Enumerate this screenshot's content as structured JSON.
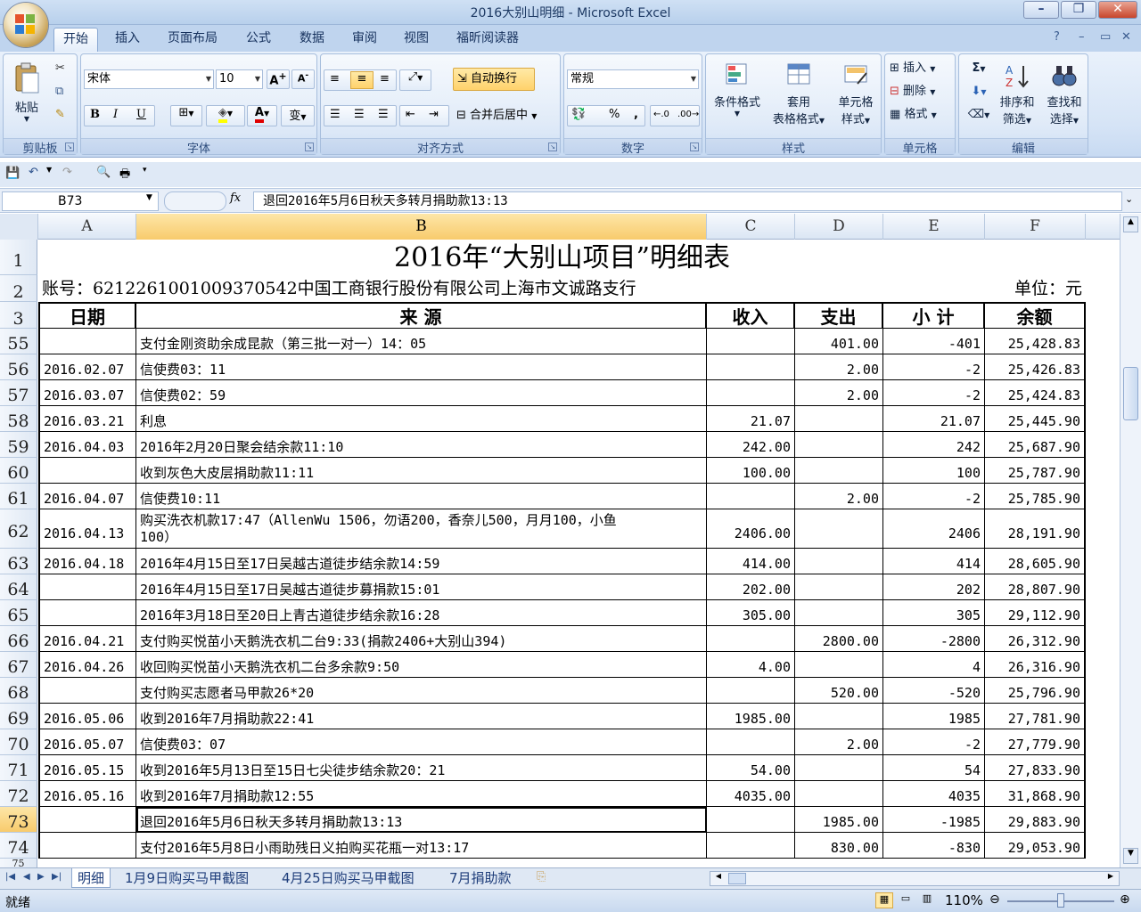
{
  "window": {
    "title": "2016大别山明细 - Microsoft Excel"
  },
  "tabs": [
    "开始",
    "插入",
    "页面布局",
    "公式",
    "数据",
    "审阅",
    "视图",
    "福昕阅读器"
  ],
  "ribbon": {
    "clipboard": {
      "paste": "粘贴",
      "label": "剪贴板"
    },
    "font": {
      "name": "宋体",
      "size": "10",
      "label": "字体",
      "bold": "B",
      "italic": "I",
      "underline": "U",
      "wen": "变"
    },
    "alignment": {
      "wrap": "自动换行",
      "merge": "合并后居中",
      "label": "对齐方式"
    },
    "number": {
      "format": "常规",
      "label": "数字",
      "percent": "%",
      "comma": ","
    },
    "styles": {
      "cond": "条件格式",
      "table1": "套用",
      "table2": "表格格式",
      "cell1": "单元格",
      "cell2": "样式",
      "label": "样式"
    },
    "cells": {
      "insert": "插入",
      "delete": "删除",
      "format": "格式",
      "label": "单元格"
    },
    "editing": {
      "sort1": "排序和",
      "sort2": "筛选",
      "find1": "查找和",
      "find2": "选择",
      "label": "编辑",
      "sigma": "Σ"
    }
  },
  "formula_bar": {
    "name_box": "B73",
    "fx": "fx",
    "content": "退回2016年5月6日秋天多转月捐助款13:13"
  },
  "columns": [
    "A",
    "B",
    "C",
    "D",
    "E",
    "F"
  ],
  "sheet": {
    "title": "2016年“大别山项目”明细表",
    "account": "账号：6212261001009370542中国工商银行股份有限公司上海市文诚路支行",
    "unit": "单位：元",
    "headers": [
      "日期",
      "来 源",
      "收入",
      "支出",
      "小 计",
      "余额"
    ],
    "rows": [
      {
        "n": "55",
        "date": "",
        "src": "支付金刚资助余成昆款（第三批一对一）14：05",
        "in": "",
        "out": "401.00",
        "sub": "-401",
        "bal": "25,428.83"
      },
      {
        "n": "56",
        "date": "2016.02.07",
        "src": "信使费03：11",
        "in": "",
        "out": "2.00",
        "sub": "-2",
        "bal": "25,426.83"
      },
      {
        "n": "57",
        "date": "2016.03.07",
        "src": "信使费02：59",
        "in": "",
        "out": "2.00",
        "sub": "-2",
        "bal": "25,424.83"
      },
      {
        "n": "58",
        "date": "2016.03.21",
        "src": "利息",
        "in": "21.07",
        "out": "",
        "sub": "21.07",
        "bal": "25,445.90"
      },
      {
        "n": "59",
        "date": "2016.04.03",
        "src": "2016年2月20日聚会结余款11:10",
        "in": "242.00",
        "out": "",
        "sub": "242",
        "bal": "25,687.90"
      },
      {
        "n": "60",
        "date": "",
        "src": "收到灰色大皮层捐助款11:11",
        "in": "100.00",
        "out": "",
        "sub": "100",
        "bal": "25,787.90"
      },
      {
        "n": "61",
        "date": "2016.04.07",
        "src": "信使费10:11",
        "in": "",
        "out": "2.00",
        "sub": "-2",
        "bal": "25,785.90"
      },
      {
        "n": "62",
        "date": "2016.04.13",
        "src": "购买洗衣机款17:47（AllenWu 1506，勿语200，香奈儿500，月月100，小鱼",
        "src2": "100）",
        "in": "2406.00",
        "out": "",
        "sub": "2406",
        "bal": "28,191.90"
      },
      {
        "n": "63",
        "date": "2016.04.18",
        "src": "2016年4月15日至17日吴越古道徒步结余款14:59",
        "in": "414.00",
        "out": "",
        "sub": "414",
        "bal": "28,605.90"
      },
      {
        "n": "64",
        "date": "",
        "src": "2016年4月15日至17日吴越古道徒步募捐款15:01",
        "in": "202.00",
        "out": "",
        "sub": "202",
        "bal": "28,807.90"
      },
      {
        "n": "65",
        "date": "",
        "src": "2016年3月18日至20日上青古道徒步结余款16:28",
        "in": "305.00",
        "out": "",
        "sub": "305",
        "bal": "29,112.90"
      },
      {
        "n": "66",
        "date": "2016.04.21",
        "src": "支付购买悦苗小天鹅洗衣机二台9:33(捐款2406+大别山394)",
        "in": "",
        "out": "2800.00",
        "sub": "-2800",
        "bal": "26,312.90"
      },
      {
        "n": "67",
        "date": "2016.04.26",
        "src": "收回购买悦苗小天鹅洗衣机二台多余款9:50",
        "in": "4.00",
        "out": "",
        "sub": "4",
        "bal": "26,316.90"
      },
      {
        "n": "68",
        "date": "",
        "src": "支付购买志愿者马甲款26*20",
        "in": "",
        "out": "520.00",
        "sub": "-520",
        "bal": "25,796.90"
      },
      {
        "n": "69",
        "date": "2016.05.06",
        "src": "收到2016年7月捐助款22:41",
        "in": "1985.00",
        "out": "",
        "sub": "1985",
        "bal": "27,781.90"
      },
      {
        "n": "70",
        "date": "2016.05.07",
        "src": "信使费03：07",
        "in": "",
        "out": "2.00",
        "sub": "-2",
        "bal": "27,779.90"
      },
      {
        "n": "71",
        "date": "2016.05.15",
        "src": "收到2016年5月13日至15日七尖徒步结余款20：21",
        "in": "54.00",
        "out": "",
        "sub": "54",
        "bal": "27,833.90"
      },
      {
        "n": "72",
        "date": "2016.05.16",
        "src": "收到2016年7月捐助款12:55",
        "in": "4035.00",
        "out": "",
        "sub": "4035",
        "bal": "31,868.90"
      },
      {
        "n": "73",
        "date": "",
        "src": "退回2016年5月6日秋天多转月捐助款13:13",
        "in": "",
        "out": "1985.00",
        "sub": "-1985",
        "bal": "29,883.90"
      },
      {
        "n": "74",
        "date": "",
        "src": "支付2016年5月8日小雨助残日义拍购买花瓶一对13:17",
        "in": "",
        "out": "830.00",
        "sub": "-830",
        "bal": "29,053.90"
      }
    ],
    "row_labels_top": [
      "1",
      "2",
      "3"
    ],
    "partial_row": "75"
  },
  "sheet_tabs": [
    "明细",
    "1月9日购买马甲截图",
    "4月25日购买马甲截图",
    "7月捐助款"
  ],
  "status": {
    "ready": "就绪",
    "zoom": "110%"
  }
}
